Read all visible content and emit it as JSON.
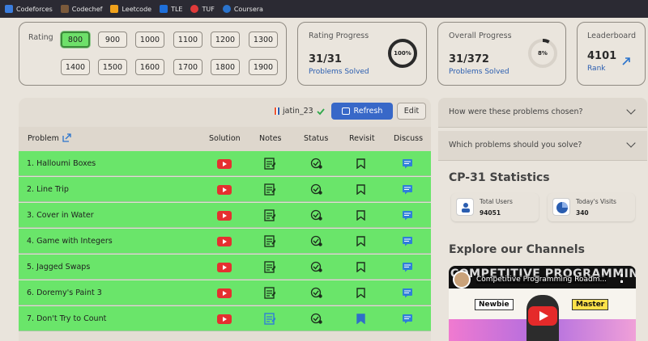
{
  "bookmarks": [
    {
      "label": "Codeforces",
      "color": "#3b7ddd"
    },
    {
      "label": "Codechef",
      "color": "#7b5a3b"
    },
    {
      "label": "Leetcode",
      "color": "#f0a21b"
    },
    {
      "label": "TLE",
      "color": "#1e6fd9"
    },
    {
      "label": "TUF",
      "color": "#e03a3a"
    },
    {
      "label": "Coursera",
      "color": "#2a73cc"
    }
  ],
  "rating": {
    "label": "Rating",
    "selected": "800",
    "options": [
      "800",
      "900",
      "1000",
      "1100",
      "1200",
      "1300",
      "1400",
      "1500",
      "1600",
      "1700",
      "1800",
      "1900"
    ]
  },
  "rating_progress": {
    "label": "Rating Progress",
    "value": "31/31",
    "sub": "Problems Solved",
    "percent_text": "100%",
    "percent": 100
  },
  "overall_progress": {
    "label": "Overall Progress",
    "value": "31/372",
    "sub": "Problems Solved",
    "percent_text": "8%",
    "percent": 8
  },
  "leaderboard": {
    "label": "Leaderboard",
    "value": "4101",
    "sub": "Rank"
  },
  "toolbar": {
    "user": "jatin_23",
    "refresh": "Refresh",
    "edit": "Edit"
  },
  "columns": {
    "problem": "Problem",
    "solution": "Solution",
    "notes": "Notes",
    "status": "Status",
    "revisit": "Revisit",
    "discuss": "Discuss"
  },
  "problems": [
    "1. Halloumi Boxes",
    "2. Line Trip",
    "3. Cover in Water",
    "4. Game with Integers",
    "5. Jagged Swaps",
    "6. Doremy's Paint 3",
    "7. Don't Try to Count"
  ],
  "faq": [
    "How were these problems chosen?",
    "Which problems should you solve?"
  ],
  "stats": {
    "title": "CP-31 Statistics",
    "total_users_label": "Total Users",
    "total_users": "94051",
    "visits_label": "Today's Visits",
    "visits": "340"
  },
  "channels": {
    "title": "Explore our Channels",
    "video_banner": "COMPETITIVE PROGRAMMING",
    "video_title": "Competitive Programming Roadm...",
    "tag_left": "Newbie",
    "tag_right": "Master"
  },
  "colors": {
    "solved_row": "#6ae56a",
    "accent_blue": "#3868c8",
    "youtube_red": "#e53030"
  }
}
